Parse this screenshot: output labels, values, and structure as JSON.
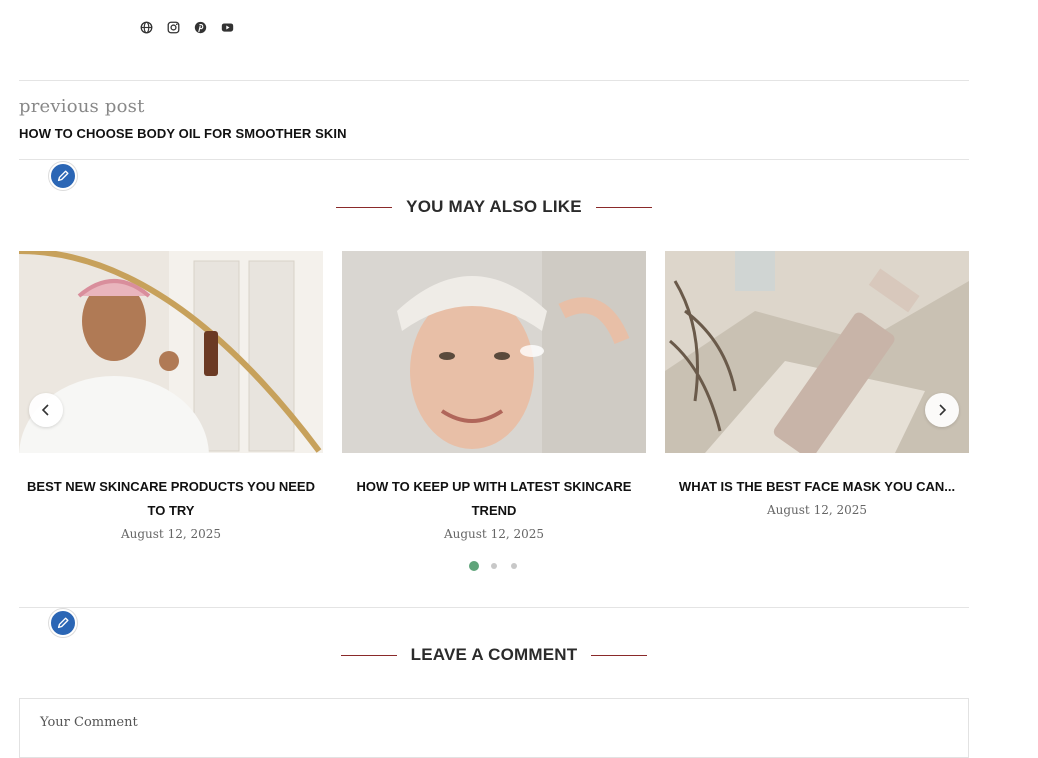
{
  "social": {
    "icons": [
      "globe-icon",
      "instagram-icon",
      "pinterest-icon",
      "youtube-icon"
    ]
  },
  "previous_post": {
    "label": "previous post",
    "title": "HOW TO CHOOSE BODY OIL FOR SMOOTHER SKIN"
  },
  "related": {
    "heading": "YOU MAY ALSO LIKE",
    "posts": [
      {
        "title": "BEST NEW SKINCARE PRODUCTS YOU NEED TO TRY",
        "date": "August 12, 2025"
      },
      {
        "title": "HOW TO KEEP UP WITH LATEST SKINCARE TREND",
        "date": "August 12, 2025"
      },
      {
        "title": "WHAT IS THE BEST FACE MASK YOU CAN...",
        "date": "August 12, 2025"
      }
    ],
    "pages": 3,
    "active_page": 1
  },
  "comments": {
    "heading": "LEAVE A COMMENT",
    "placeholder": "Your Comment"
  },
  "colors": {
    "accent_badge": "#2b66b5",
    "heading_line": "#8a2a2a",
    "active_dot": "#5fa47a"
  }
}
